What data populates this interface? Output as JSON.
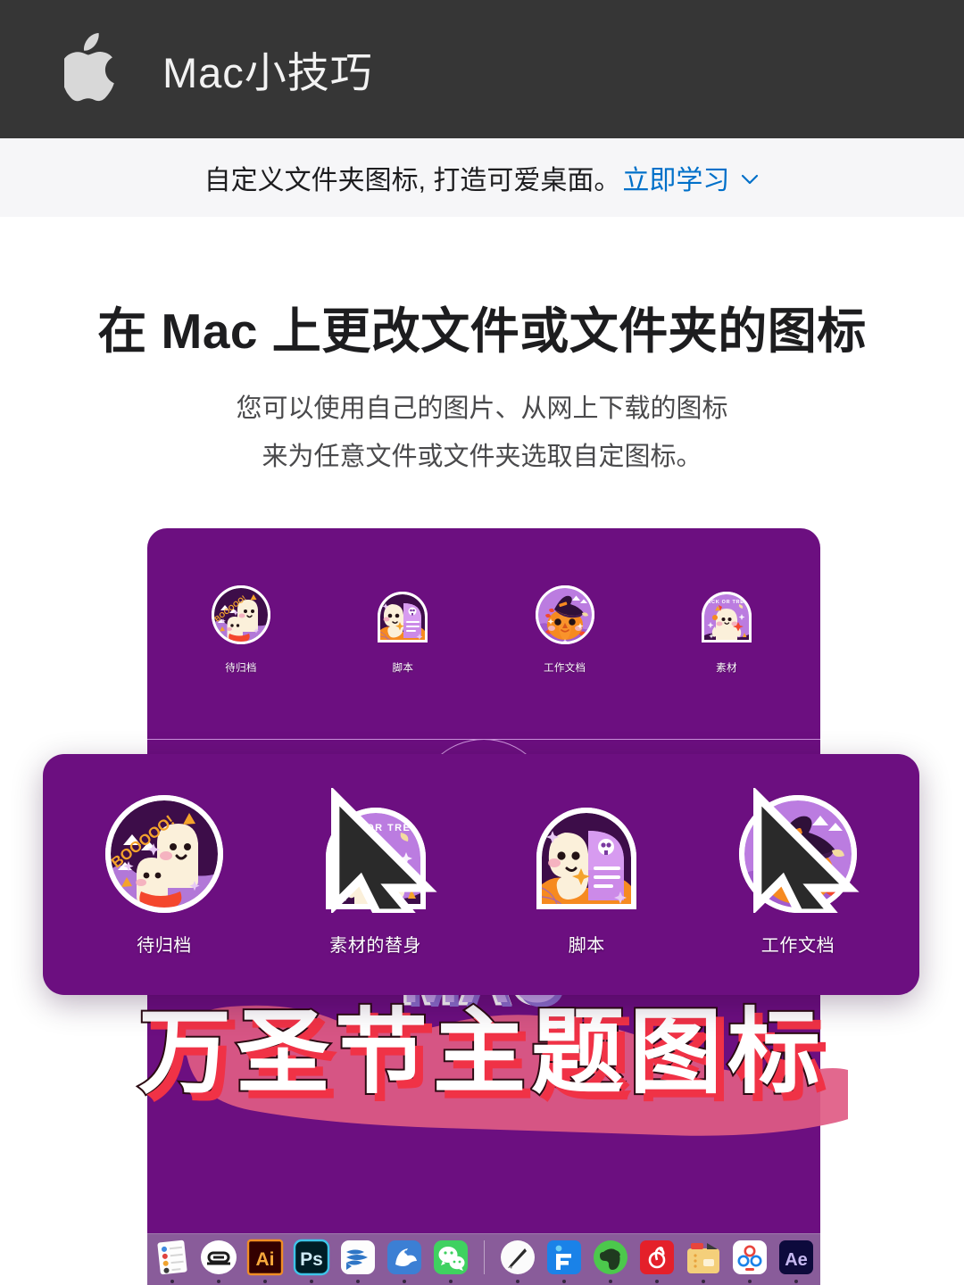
{
  "navbar": {
    "logo_icon": "apple-logo-icon",
    "title": "Mac小技巧",
    "background_color": "#363636",
    "logo_color": "#d8d8d8"
  },
  "banner": {
    "text": "自定义文件夹图标, 打造可爱桌面。",
    "link_label": "立即学习",
    "link_color": "#0070c9",
    "chevron_icon": "chevron-down-icon",
    "background_color": "#f6f6f8"
  },
  "hero": {
    "title": "在 Mac 上更改文件或文件夹的图标",
    "subtitle_line1": "您可以使用自己的图片、从网上下载的图标",
    "subtitle_line2": "来为任意文件或文件夹选取自定图标。"
  },
  "desktop": {
    "background_color": "#6c0f80",
    "back_card": {
      "icons": [
        {
          "label": "待归档",
          "art": "ghost-boooo-round-icon"
        },
        {
          "label": "脚本",
          "art": "ghost-tombstone-arch-icon"
        },
        {
          "label": "工作文档",
          "art": "pumpkin-witch-round-icon"
        },
        {
          "label": "素材",
          "art": "ghost-trick-or-treat-arch-icon"
        }
      ]
    },
    "front_card": {
      "icons": [
        {
          "label": "待归档",
          "art": "ghost-boooo-round-icon",
          "alias": false
        },
        {
          "label": "素材的替身",
          "art": "ghost-trick-or-treat-arch-icon",
          "alias": true
        },
        {
          "label": "脚本",
          "art": "ghost-tombstone-arch-icon",
          "alias": false
        },
        {
          "label": "工作文档",
          "art": "pumpkin-witch-round-icon",
          "alias": true
        }
      ]
    },
    "dock": {
      "items": [
        {
          "name": "reminders",
          "label": "提醒事项"
        },
        {
          "name": "app-white-oval",
          "label": "Sketch"
        },
        {
          "name": "adobe-illustrator",
          "label": "Ai"
        },
        {
          "name": "adobe-photoshop",
          "label": "Ps"
        },
        {
          "name": "app-blue-waves",
          "label": "Ulysses"
        },
        {
          "name": "app-blue-bird",
          "label": "Sparrow"
        },
        {
          "name": "wechat",
          "label": "微信"
        },
        {
          "name": "divider",
          "label": ""
        },
        {
          "name": "app-pen-nib",
          "label": "Notes"
        },
        {
          "name": "app-blue-f",
          "label": "F"
        },
        {
          "name": "evernote",
          "label": "印象笔记"
        },
        {
          "name": "netease-music",
          "label": "网易云音乐"
        },
        {
          "name": "app-yellow-folder",
          "label": "Folder"
        },
        {
          "name": "baidu-netdisk",
          "label": "百度网盘"
        },
        {
          "name": "adobe-after-effects",
          "label": "Ae"
        }
      ]
    }
  },
  "poster": {
    "line_small": "MAC",
    "line_big": "万圣节主题图标",
    "small_fill_color": "#c5a8ee",
    "big_fill_color": "#ffffff",
    "big_shadow_color": "#f03246",
    "blob_color": "#e05b84"
  }
}
